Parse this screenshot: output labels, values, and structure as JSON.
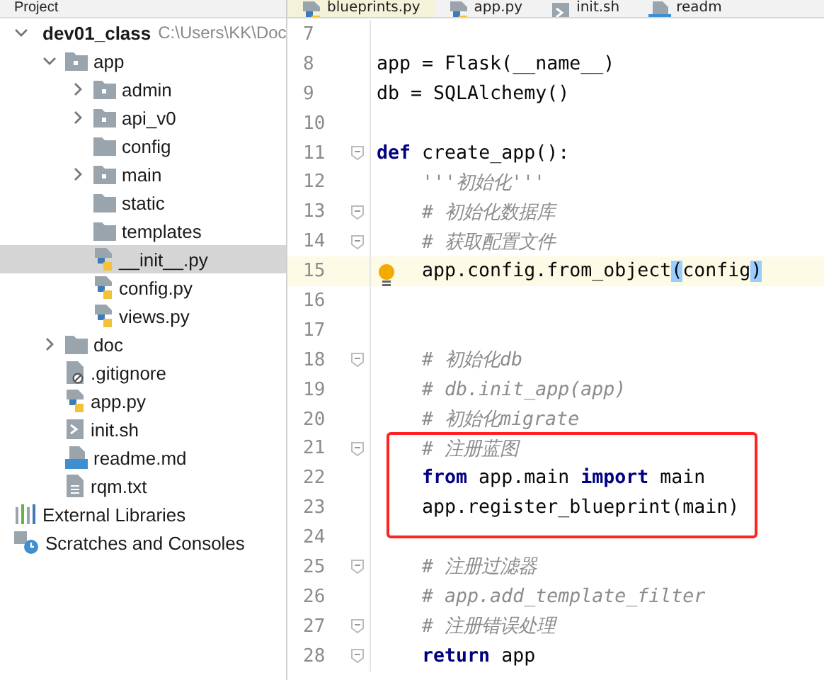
{
  "project_bar": {
    "title": "Project"
  },
  "tabs": [
    {
      "label": "blueprints.py",
      "kind": "python",
      "selected": true
    },
    {
      "label": "app.py",
      "kind": "python",
      "selected": false
    },
    {
      "label": "init.sh",
      "kind": "shell",
      "selected": false
    },
    {
      "label": "readm",
      "kind": "markdown",
      "selected": false
    }
  ],
  "tree": [
    {
      "label": "dev01_class",
      "path": "C:\\Users\\KK\\Doc",
      "kind": "root",
      "expanded": true,
      "selected": false,
      "children": [
        {
          "label": "app",
          "kind": "package",
          "expanded": true,
          "selected": false,
          "children": [
            {
              "label": "admin",
              "kind": "package",
              "expanded": false,
              "selected": false
            },
            {
              "label": "api_v0",
              "kind": "package",
              "expanded": false,
              "selected": false
            },
            {
              "label": "config",
              "kind": "folder",
              "selected": false
            },
            {
              "label": "main",
              "kind": "package",
              "expanded": false,
              "selected": false
            },
            {
              "label": "static",
              "kind": "folder",
              "selected": false
            },
            {
              "label": "templates",
              "kind": "folder",
              "selected": false
            },
            {
              "label": "__init__.py",
              "kind": "python",
              "selected": true
            },
            {
              "label": "config.py",
              "kind": "python",
              "selected": false
            },
            {
              "label": "views.py",
              "kind": "python",
              "selected": false
            }
          ]
        },
        {
          "label": "doc",
          "kind": "folder",
          "expanded": false,
          "selected": false
        },
        {
          "label": ".gitignore",
          "kind": "ignore",
          "selected": false
        },
        {
          "label": "app.py",
          "kind": "python",
          "selected": false
        },
        {
          "label": "init.sh",
          "kind": "shell",
          "selected": false
        },
        {
          "label": "readme.md",
          "kind": "markdown",
          "selected": false
        },
        {
          "label": "rqm.txt",
          "kind": "text",
          "selected": false
        }
      ]
    },
    {
      "label": "External Libraries",
      "kind": "libraries",
      "selected": false
    },
    {
      "label": "Scratches and Consoles",
      "kind": "scratches",
      "selected": false
    }
  ],
  "editor": {
    "lines": [
      {
        "number": "7",
        "current": false
      },
      {
        "number": "8",
        "current": false,
        "tokens": [
          {
            "text": "app = Flask(__name__)",
            "kind": "plain"
          }
        ]
      },
      {
        "number": "9",
        "current": false,
        "tokens": [
          {
            "text": "db = SQLAlchemy()",
            "kind": "plain"
          }
        ]
      },
      {
        "number": "10",
        "current": false
      },
      {
        "number": "11",
        "current": false,
        "fold": true,
        "tokens": [
          {
            "text": "def",
            "kind": "keyword"
          },
          {
            "text": " create_app():",
            "kind": "plain"
          }
        ]
      },
      {
        "number": "12",
        "current": false,
        "tokens": [
          {
            "text": "    '''初始化'''",
            "kind": "comment"
          }
        ]
      },
      {
        "number": "13",
        "current": false,
        "fold": true,
        "tokens": [
          {
            "text": "    # 初始化数据库",
            "kind": "comment"
          }
        ]
      },
      {
        "number": "14",
        "current": false,
        "fold": true,
        "tokens": [
          {
            "text": "    # 获取配置文件",
            "kind": "comment"
          }
        ]
      },
      {
        "number": "15",
        "current": true,
        "bulb": true,
        "tokens": [
          {
            "text": "    app.config.from_object",
            "kind": "plain"
          },
          {
            "text": "(",
            "kind": "match"
          },
          {
            "text": "config",
            "kind": "plain"
          },
          {
            "text": ")",
            "kind": "match"
          }
        ]
      },
      {
        "number": "16",
        "current": false
      },
      {
        "number": "17",
        "current": false
      },
      {
        "number": "18",
        "current": false,
        "fold": true,
        "tokens": [
          {
            "text": "    # 初始化db",
            "kind": "comment"
          }
        ]
      },
      {
        "number": "19",
        "current": false,
        "tokens": [
          {
            "text": "    # db.init_app(app)",
            "kind": "comment"
          }
        ]
      },
      {
        "number": "20",
        "current": false,
        "tokens": [
          {
            "text": "    # 初始化migrate",
            "kind": "comment"
          }
        ]
      },
      {
        "number": "21",
        "current": false,
        "fold": true,
        "boxed": true,
        "tokens": [
          {
            "text": "    # 注册蓝图",
            "kind": "comment"
          }
        ]
      },
      {
        "number": "22",
        "current": false,
        "boxed": true,
        "tokens": [
          {
            "text": "    from",
            "kind": "keyword"
          },
          {
            "text": " app.main ",
            "kind": "plain"
          },
          {
            "text": "import",
            "kind": "keyword"
          },
          {
            "text": " main",
            "kind": "plain"
          }
        ]
      },
      {
        "number": "23",
        "current": false,
        "boxed": true,
        "tokens": [
          {
            "text": "    app.register_blueprint(main)",
            "kind": "plain"
          }
        ]
      },
      {
        "number": "24",
        "current": false
      },
      {
        "number": "25",
        "current": false,
        "fold": true,
        "tokens": [
          {
            "text": "    # 注册过滤器",
            "kind": "comment"
          }
        ]
      },
      {
        "number": "26",
        "current": false,
        "tokens": [
          {
            "text": "    # app.add_template_filter",
            "kind": "comment"
          }
        ]
      },
      {
        "number": "27",
        "current": false,
        "fold": true,
        "tokens": [
          {
            "text": "    # 注册错误处理",
            "kind": "comment"
          }
        ]
      },
      {
        "number": "28",
        "current": false,
        "fold": true,
        "tokens": [
          {
            "text": "    return",
            "kind": "keyword"
          },
          {
            "text": " app",
            "kind": "plain"
          }
        ]
      }
    ]
  }
}
